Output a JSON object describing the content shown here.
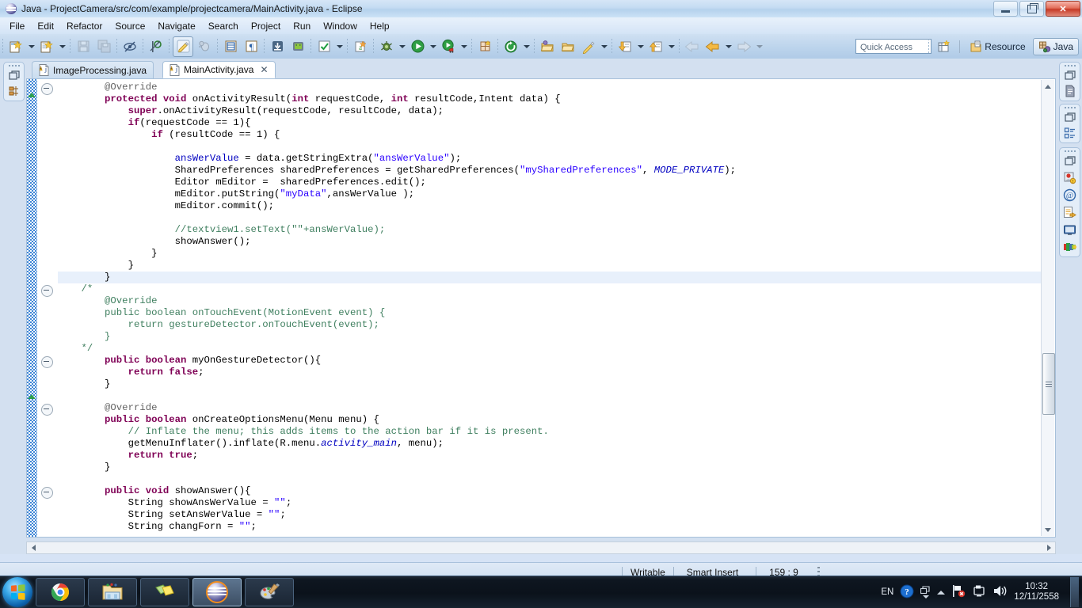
{
  "window": {
    "title": "Java - ProjectCamera/src/com/example/projectcamera/MainActivity.java - Eclipse",
    "controls": {
      "minimize": "minimize-button",
      "restore": "restore-button",
      "close": "✕"
    }
  },
  "menubar": {
    "items": [
      "File",
      "Edit",
      "Refactor",
      "Source",
      "Navigate",
      "Search",
      "Project",
      "Run",
      "Window",
      "Help"
    ]
  },
  "toolbar": {
    "quick_access_placeholder": "Quick Access",
    "perspectives": [
      {
        "label": "Resource",
        "icon": "resource-perspective-icon",
        "active": false
      },
      {
        "label": "Java",
        "icon": "java-perspective-icon",
        "active": true
      }
    ],
    "buttons": [
      "new-wizard",
      "new-java-project",
      "save",
      "save-all",
      "toggle-mark-occurrences",
      "skip-all-breakpoints",
      "new-android-xml",
      "debug-android",
      "open-layout",
      "new-paragraph",
      "android-sdk-manager",
      "android-virtual-device-manager",
      "run-last-tool",
      "new-annotation",
      "debug",
      "run",
      "coverage",
      "new-class",
      "refresh",
      "open-type",
      "open-task",
      "external-tools",
      "next-annotation",
      "previous-annotation",
      "back",
      "forward"
    ]
  },
  "editor": {
    "tabs": [
      {
        "label": "ImageProcessing.java",
        "active": false,
        "closable": false
      },
      {
        "label": "MainActivity.java",
        "active": true,
        "closable": true,
        "close_glyph": "✕"
      }
    ],
    "highlighted_line_index": 16,
    "code_lines": [
      [
        {
          "t": "        ",
          "c": "m"
        },
        {
          "t": "@Override",
          "c": "a"
        }
      ],
      [
        {
          "t": "        ",
          "c": "m"
        },
        {
          "t": "protected void",
          "c": "k"
        },
        {
          "t": " onActivityResult(",
          "c": "m"
        },
        {
          "t": "int",
          "c": "k"
        },
        {
          "t": " requestCode, ",
          "c": "m"
        },
        {
          "t": "int",
          "c": "k"
        },
        {
          "t": " resultCode,Intent data) {",
          "c": "m"
        }
      ],
      [
        {
          "t": "            ",
          "c": "m"
        },
        {
          "t": "super",
          "c": "k"
        },
        {
          "t": ".onActivityResult(requestCode, resultCode, data);",
          "c": "m"
        }
      ],
      [
        {
          "t": "            ",
          "c": "m"
        },
        {
          "t": "if",
          "c": "k"
        },
        {
          "t": "(requestCode == 1){",
          "c": "m"
        }
      ],
      [
        {
          "t": "                ",
          "c": "m"
        },
        {
          "t": "if",
          "c": "k"
        },
        {
          "t": " (resultCode == 1) {",
          "c": "m"
        }
      ],
      [
        {
          "t": "",
          "c": "m"
        }
      ],
      [
        {
          "t": "                    ",
          "c": "m"
        },
        {
          "t": "ansWerValue",
          "c": "f"
        },
        {
          "t": " = data.getStringExtra(",
          "c": "m"
        },
        {
          "t": "\"ansWerValue\"",
          "c": "s"
        },
        {
          "t": ");",
          "c": "m"
        }
      ],
      [
        {
          "t": "                    ",
          "c": "m"
        },
        {
          "t": "SharedPreferences sharedPreferences = getSharedPreferences(",
          "c": "m"
        },
        {
          "t": "\"mySharedPreferences\"",
          "c": "s"
        },
        {
          "t": ", ",
          "c": "m"
        },
        {
          "t": "MODE_PRIVATE",
          "c": "st"
        },
        {
          "t": ");",
          "c": "m"
        }
      ],
      [
        {
          "t": "                    ",
          "c": "m"
        },
        {
          "t": "Editor mEditor =  sharedPreferences.edit();",
          "c": "m"
        }
      ],
      [
        {
          "t": "                    ",
          "c": "m"
        },
        {
          "t": "mEditor.putString(",
          "c": "m"
        },
        {
          "t": "\"myData\"",
          "c": "s"
        },
        {
          "t": ",ansWerValue );",
          "c": "m"
        }
      ],
      [
        {
          "t": "                    ",
          "c": "m"
        },
        {
          "t": "mEditor.commit();",
          "c": "m"
        }
      ],
      [
        {
          "t": "",
          "c": "m"
        }
      ],
      [
        {
          "t": "                    ",
          "c": "m"
        },
        {
          "t": "//textview1.setText(\"\"+ansWerValue);",
          "c": "c"
        }
      ],
      [
        {
          "t": "                    ",
          "c": "m"
        },
        {
          "t": "showAnswer();",
          "c": "m"
        }
      ],
      [
        {
          "t": "                ",
          "c": "m"
        },
        {
          "t": "}",
          "c": "m"
        }
      ],
      [
        {
          "t": "            ",
          "c": "m"
        },
        {
          "t": "}",
          "c": "m"
        }
      ],
      [
        {
          "t": "        ",
          "c": "m"
        },
        {
          "t": "}",
          "c": "m"
        }
      ],
      [
        {
          "t": "    ",
          "c": "m"
        },
        {
          "t": "/*",
          "c": "c"
        }
      ],
      [
        {
          "t": "        ",
          "c": "m"
        },
        {
          "t": "@Override",
          "c": "c"
        }
      ],
      [
        {
          "t": "        ",
          "c": "m"
        },
        {
          "t": "public boolean onTouchEvent(MotionEvent event) {",
          "c": "c"
        }
      ],
      [
        {
          "t": "            ",
          "c": "m"
        },
        {
          "t": "return gestureDetector.onTouchEvent(event);",
          "c": "c"
        }
      ],
      [
        {
          "t": "        ",
          "c": "m"
        },
        {
          "t": "}",
          "c": "c"
        }
      ],
      [
        {
          "t": "    ",
          "c": "m"
        },
        {
          "t": "*/",
          "c": "c"
        }
      ],
      [
        {
          "t": "        ",
          "c": "m"
        },
        {
          "t": "public boolean",
          "c": "k"
        },
        {
          "t": " myOnGestureDetector(){",
          "c": "m"
        }
      ],
      [
        {
          "t": "            ",
          "c": "m"
        },
        {
          "t": "return false",
          "c": "k"
        },
        {
          "t": ";",
          "c": "m"
        }
      ],
      [
        {
          "t": "        ",
          "c": "m"
        },
        {
          "t": "}",
          "c": "m"
        }
      ],
      [
        {
          "t": "",
          "c": "m"
        }
      ],
      [
        {
          "t": "        ",
          "c": "m"
        },
        {
          "t": "@Override",
          "c": "a"
        }
      ],
      [
        {
          "t": "        ",
          "c": "m"
        },
        {
          "t": "public boolean",
          "c": "k"
        },
        {
          "t": " onCreateOptionsMenu(Menu menu) {",
          "c": "m"
        }
      ],
      [
        {
          "t": "            ",
          "c": "m"
        },
        {
          "t": "// Inflate the menu; this adds items to the action bar if it is present.",
          "c": "c"
        }
      ],
      [
        {
          "t": "            ",
          "c": "m"
        },
        {
          "t": "getMenuInflater().inflate(R.menu.",
          "c": "m"
        },
        {
          "t": "activity_main",
          "c": "sf"
        },
        {
          "t": ", menu);",
          "c": "m"
        }
      ],
      [
        {
          "t": "            ",
          "c": "m"
        },
        {
          "t": "return true",
          "c": "k"
        },
        {
          "t": ";",
          "c": "m"
        }
      ],
      [
        {
          "t": "        ",
          "c": "m"
        },
        {
          "t": "}",
          "c": "m"
        }
      ],
      [
        {
          "t": "",
          "c": "m"
        }
      ],
      [
        {
          "t": "        ",
          "c": "m"
        },
        {
          "t": "public void",
          "c": "k"
        },
        {
          "t": " showAnswer(){",
          "c": "m"
        }
      ],
      [
        {
          "t": "            ",
          "c": "m"
        },
        {
          "t": "String showAnsWerValue = ",
          "c": "m"
        },
        {
          "t": "\"\"",
          "c": "s"
        },
        {
          "t": ";",
          "c": "m"
        }
      ],
      [
        {
          "t": "            ",
          "c": "m"
        },
        {
          "t": "String setAnsWerValue = ",
          "c": "m"
        },
        {
          "t": "\"\"",
          "c": "s"
        },
        {
          "t": ";",
          "c": "m"
        }
      ],
      [
        {
          "t": "            ",
          "c": "m"
        },
        {
          "t": "String changForn = ",
          "c": "m"
        },
        {
          "t": "\"\"",
          "c": "s"
        },
        {
          "t": ";",
          "c": "m"
        }
      ]
    ],
    "fold_line_indices": [
      0,
      17,
      23,
      27,
      34
    ],
    "change_marker_line_indices": [
      1,
      26
    ]
  },
  "statusbar": {
    "writable": "Writable",
    "insert_mode": "Smart Insert",
    "position": "159 : 9"
  },
  "taskbar": {
    "start": "start-button",
    "tasks": [
      {
        "name": "chrome",
        "active": false
      },
      {
        "name": "file-explorer",
        "active": false
      },
      {
        "name": "sticky-notes",
        "active": false
      },
      {
        "name": "eclipse",
        "active": true
      },
      {
        "name": "paint",
        "active": false
      }
    ],
    "tray": {
      "language": "EN",
      "help": "?",
      "time": "10:32",
      "date": "12/11/2558"
    }
  },
  "colors": {
    "keyword": "#7f0055",
    "string": "#2a00ff",
    "comment": "#3f7f5f",
    "annotation": "#646464",
    "field": "#0000c0",
    "chrome_blue": "#b5d1ec",
    "highlight_line": "#e8f0fb"
  }
}
